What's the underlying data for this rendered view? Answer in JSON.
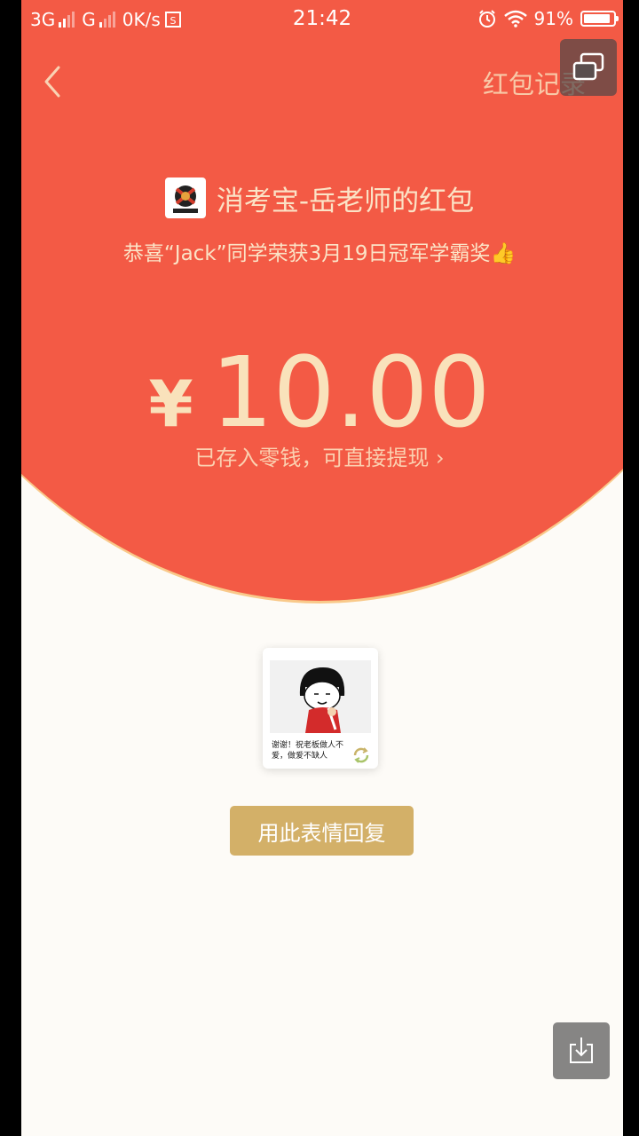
{
  "status_bar": {
    "net1": "3G",
    "net2": "G",
    "speed": "0K/s",
    "time": "21:42",
    "battery": "91%",
    "battery_level": 0.91
  },
  "header": {
    "record_label": "红包记录"
  },
  "packet": {
    "sender": "消考宝-岳老师的红包",
    "greeting": "恭喜“Jack”同学荣获3月19日冠军学霸奖👍",
    "currency": "¥",
    "amount": "10.00",
    "note": "已存入零钱，可直接提现",
    "note_arrow": "›"
  },
  "sticker": {
    "caption": "谢谢！祝老板做人不爱，做爱不缺人"
  },
  "reply": {
    "label": "用此表情回复"
  },
  "colors": {
    "header_red": "#f35a45",
    "gold_text": "#f9e2bb",
    "button_gold": "#d3b068",
    "page_bg": "#fdfbf7"
  },
  "icons": [
    "back-arrow-icon",
    "floating-window-icon",
    "app-logo-icon",
    "refresh-icon",
    "save-download-icon",
    "alarm-icon",
    "wifi-icon",
    "battery-icon",
    "signal-icon"
  ]
}
